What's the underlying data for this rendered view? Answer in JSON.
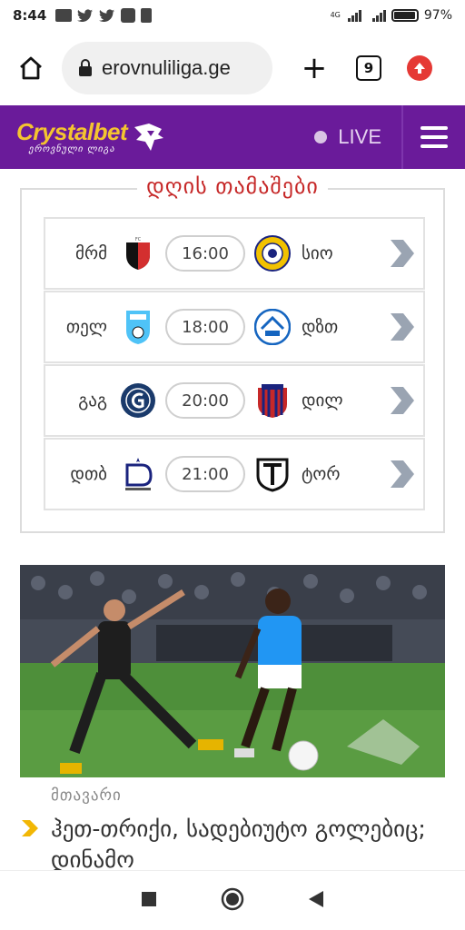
{
  "status_bar": {
    "time": "8:44",
    "network": "4G",
    "battery_percent": "97%",
    "battery_level": 0.97
  },
  "browser": {
    "url": "erovnuliliga.ge",
    "tab_count": "9"
  },
  "header": {
    "logo_main": "Crystalbet",
    "logo_sub": "ეროვნული ლიგა",
    "live_label": "LIVE",
    "colors": {
      "bar": "#6a1b9a",
      "logo": "#f4c430"
    }
  },
  "games": {
    "title": "დღის თამაშები",
    "matches": [
      {
        "home": "მრმ",
        "time": "16:00",
        "away": "სიო"
      },
      {
        "home": "თელ",
        "time": "18:00",
        "away": "დზთ"
      },
      {
        "home": "გაგ",
        "time": "20:00",
        "away": "დილ"
      },
      {
        "home": "დთბ",
        "time": "21:00",
        "away": "ტორ"
      }
    ]
  },
  "article": {
    "category": "მთავარი",
    "title": "ჰეთ-თრიქი, სადებიუტო გოლებიც; დინამო"
  },
  "nav": {
    "icons": [
      "recent-apps-icon",
      "home-icon",
      "back-icon"
    ]
  }
}
